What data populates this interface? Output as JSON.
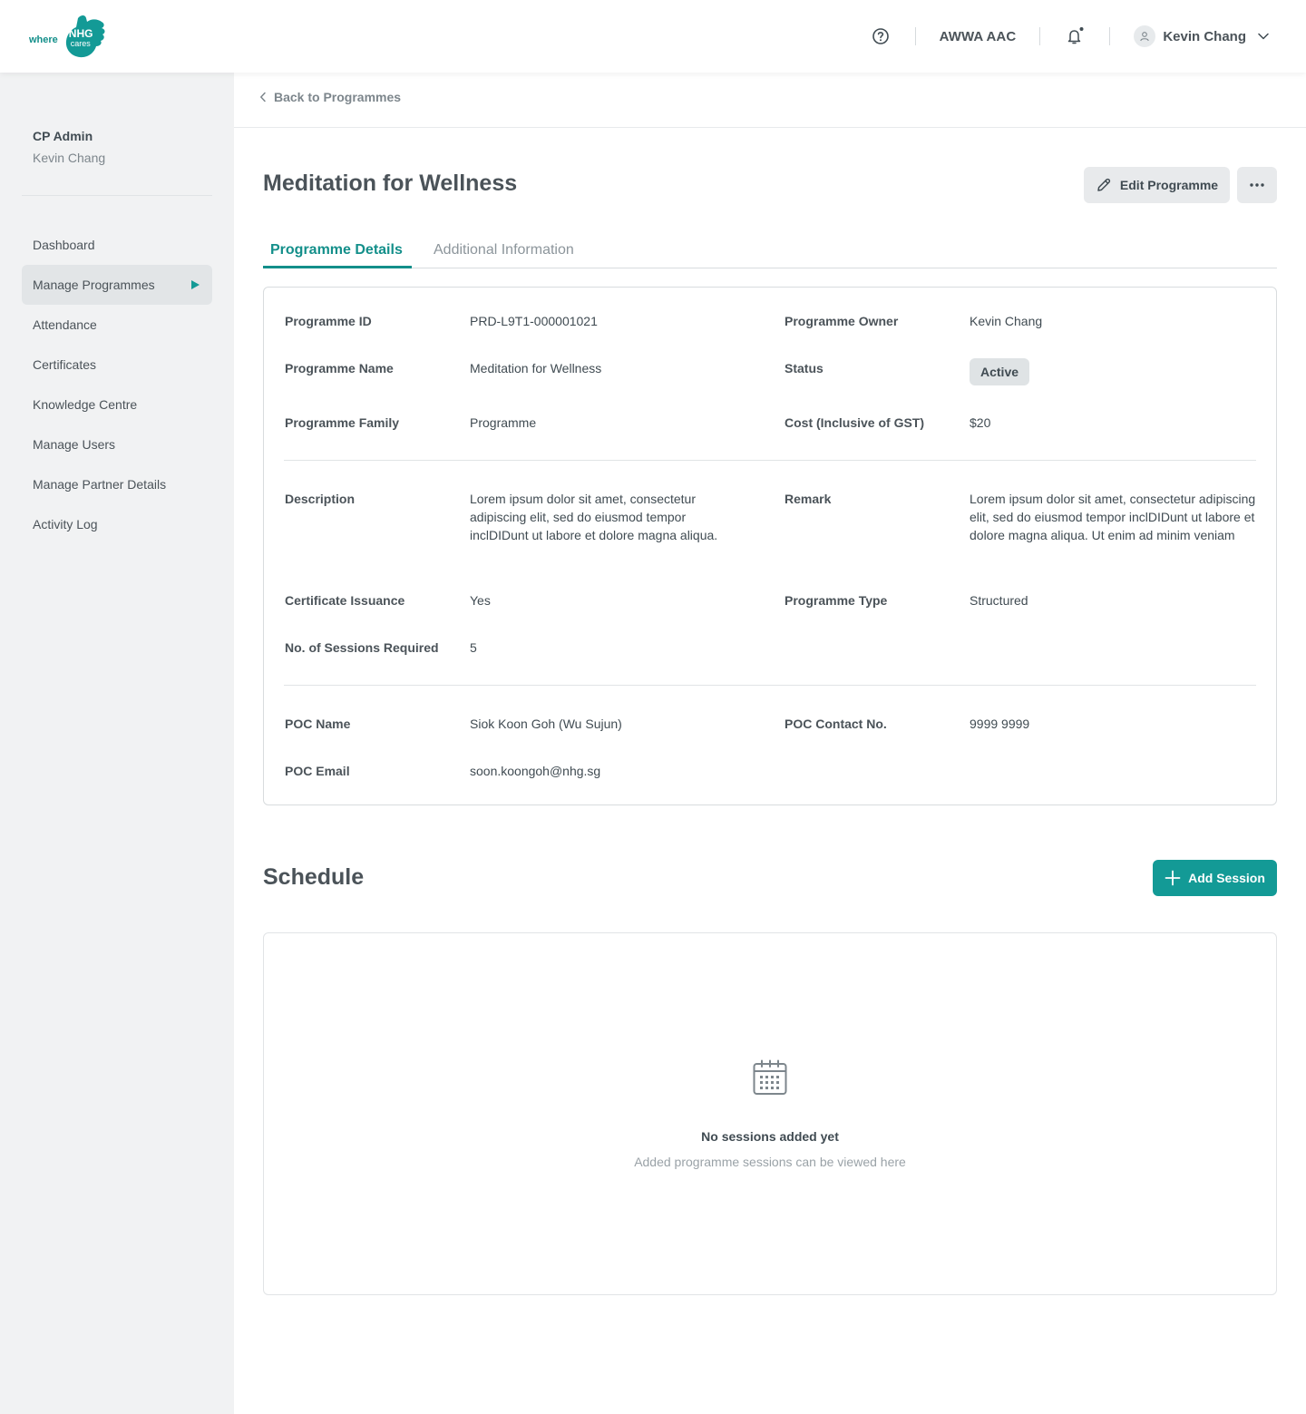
{
  "header": {
    "logo_where": "where",
    "logo_brand": "NHG",
    "logo_cares": "cares",
    "help_icon": "help-circle-icon",
    "organisation": "AWWA AAC",
    "bell_icon": "bell-icon",
    "user_name": "Kevin Chang"
  },
  "sidebar": {
    "role": "CP Admin",
    "name": "Kevin Chang",
    "items": [
      {
        "label": "Dashboard"
      },
      {
        "label": "Manage Programmes"
      },
      {
        "label": "Attendance"
      },
      {
        "label": "Certificates"
      },
      {
        "label": "Knowledge Centre"
      },
      {
        "label": "Manage Users"
      },
      {
        "label": "Manage Partner Details"
      },
      {
        "label": "Activity Log"
      }
    ],
    "active_index": 1
  },
  "breadcrumb": {
    "back_label": "Back to Programmes"
  },
  "page": {
    "title": "Meditation for Wellness",
    "edit_label": "Edit Programme",
    "more_label": "…"
  },
  "tabs": {
    "details": "Programme Details",
    "additional": "Additional Information"
  },
  "details": {
    "programme_id_label": "Programme ID",
    "programme_id": "PRD-L9T1-000001021",
    "programme_owner_label": "Programme Owner",
    "programme_owner": "Kevin Chang",
    "programme_name_label": "Programme Name",
    "programme_name": "Meditation for Wellness",
    "status_label": "Status",
    "status": "Active",
    "programme_family_label": "Programme Family",
    "programme_family": "Programme",
    "cost_label": "Cost (Inclusive of GST)",
    "cost": "$20",
    "description_label": "Description",
    "description": "Lorem ipsum dolor sit amet, consectetur adipiscing elit, sed do eiusmod tempor inclDIDunt ut labore et dolore magna aliqua.",
    "remark_label": "Remark",
    "remark": "Lorem ipsum dolor sit amet, consectetur adipiscing elit, sed do eiusmod tempor inclDIDunt ut labore et dolore magna aliqua. Ut enim ad minim veniam",
    "certificate_label": "Certificate Issuance",
    "certificate": "Yes",
    "programme_type_label": "Programme Type",
    "programme_type": "Structured",
    "sessions_label": "No. of Sessions Required",
    "sessions": "5",
    "poc_name_label": "POC Name",
    "poc_name": "Siok Koon Goh (Wu Sujun)",
    "poc_contact_label": "POC Contact No.",
    "poc_contact": "9999 9999",
    "poc_email_label": "POC Email",
    "poc_email": "soon.koongoh@nhg.sg"
  },
  "schedule": {
    "title": "Schedule",
    "add_label": "Add Session",
    "empty_title": "No sessions added yet",
    "empty_subtitle": "Added programme sessions can be viewed here"
  },
  "colors": {
    "accent": "#139a96",
    "sidebar_bg": "#f1f2f3"
  }
}
